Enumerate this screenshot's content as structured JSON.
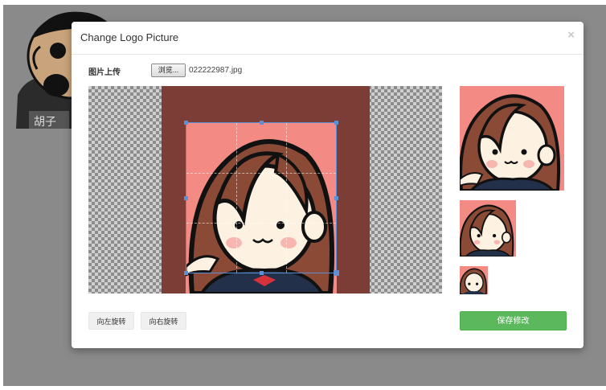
{
  "dialog": {
    "title": "Change Logo Picture",
    "close_glyph": "×"
  },
  "upload": {
    "label": "图片上传",
    "browse_label": "浏览...",
    "file_name": "022222987.jpg"
  },
  "background": {
    "avatar_caption": "胡子",
    "avatar_icon": "bearded-man-avatar"
  },
  "crop": {
    "icon": "girl-avatar-image"
  },
  "previews": {
    "icon": "girl-avatar-preview"
  },
  "actions": {
    "rotate_left": "向左旋转",
    "rotate_right": "向右旋转",
    "save": "保存修改"
  },
  "colors": {
    "accent_save": "#5cb85c",
    "crop_border": "#5b8fd8",
    "image_bg": "#7d3d37",
    "preview_bg": "#f38a83"
  }
}
